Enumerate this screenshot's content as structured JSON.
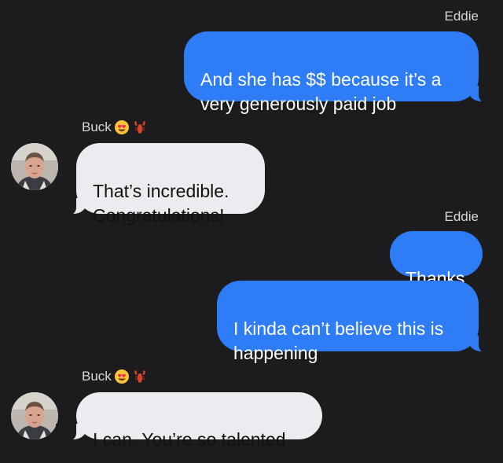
{
  "thread": {
    "messages": [
      {
        "sender": "Eddie",
        "direction": "outgoing",
        "text": "And she has $$ because it’s a\nvery generously paid job"
      },
      {
        "sender": "Buck",
        "direction": "incoming",
        "text": "That’s incredible.\nCongratulations!"
      },
      {
        "sender": "Eddie",
        "direction": "outgoing",
        "text": "Thanks"
      },
      {
        "sender": "Eddie",
        "direction": "outgoing",
        "text": "I kinda can’t believe this is\nhappening"
      },
      {
        "sender": "Buck",
        "direction": "incoming",
        "text": "I can. You’re so talented"
      }
    ],
    "sender_labels": {
      "eddie": "Eddie",
      "buck": "Buck"
    },
    "buck_emojis": [
      "😍",
      "🦞"
    ]
  },
  "colors": {
    "background": "#1c1c1e",
    "outgoing_bubble": "#2e7cf6",
    "incoming_bubble": "#ececf0"
  },
  "icons": {
    "avatar": "buck-avatar-photo",
    "emoji_1": "heart-eyes-emoji",
    "emoji_2": "lobster-emoji"
  }
}
